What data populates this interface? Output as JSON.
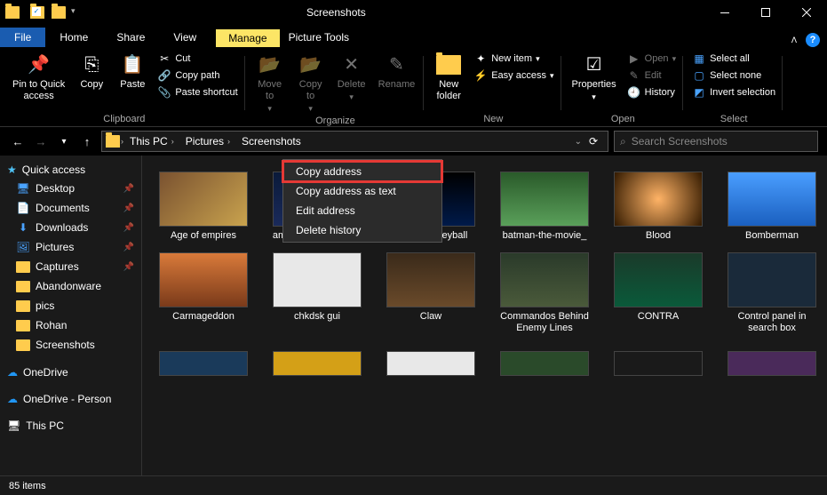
{
  "window_title": "Screenshots",
  "ribbon_group_tab": "Manage",
  "ribbon_group_sub": "Picture Tools",
  "tabs": {
    "file": "File",
    "home": "Home",
    "share": "Share",
    "view": "View"
  },
  "ribbon": {
    "pin": "Pin to Quick\naccess",
    "copy": "Copy",
    "paste": "Paste",
    "cut": "Cut",
    "copy_path": "Copy path",
    "paste_shortcut": "Paste shortcut",
    "clipboard": "Clipboard",
    "move_to": "Move\nto",
    "copy_to": "Copy\nto",
    "delete": "Delete",
    "rename": "Rename",
    "organize": "Organize",
    "new_folder": "New\nfolder",
    "new_item": "New item",
    "easy_access": "Easy access",
    "new": "New",
    "properties": "Properties",
    "open_btn": "Open",
    "edit": "Edit",
    "history": "History",
    "open_grp": "Open",
    "select_all": "Select all",
    "select_none": "Select none",
    "invert_selection": "Invert selection",
    "select": "Select"
  },
  "breadcrumb": [
    "This PC",
    "Pictures",
    "Screenshots"
  ],
  "search_placeholder": "Search Screenshots",
  "context_menu": [
    "Copy address",
    "Copy address as text",
    "Edit address",
    "Delete history"
  ],
  "sidebar": {
    "quick_access": "Quick access",
    "items": [
      {
        "label": "Desktop",
        "pin": true,
        "icon": "desktop"
      },
      {
        "label": "Documents",
        "pin": true,
        "icon": "doc"
      },
      {
        "label": "Downloads",
        "pin": true,
        "icon": "download"
      },
      {
        "label": "Pictures",
        "pin": true,
        "icon": "pic"
      },
      {
        "label": "Captures",
        "pin": true,
        "icon": "folder"
      },
      {
        "label": "Abandonware",
        "pin": false,
        "icon": "folder"
      },
      {
        "label": "pics",
        "pin": false,
        "icon": "folder"
      },
      {
        "label": "Rohan",
        "pin": false,
        "icon": "folder"
      },
      {
        "label": "Screenshots",
        "pin": false,
        "icon": "folder"
      }
    ],
    "onedrive1": "OneDrive",
    "onedrive2": "OneDrive - Person",
    "thispc": "This PC"
  },
  "files": [
    "Age of empires",
    "amazing-spider-man",
    "arcade-volleyball",
    "batman-the-movie_",
    "Blood",
    "Bomberman",
    "Carmageddon",
    "chkdsk gui",
    "Claw",
    "Commandos Behind Enemy Lines",
    "CONTRA",
    "Control panel in search box"
  ],
  "thumbs": [
    "linear-gradient(135deg,#7a5230,#c9a34e)",
    "linear-gradient(#0a1a3a,#1a2a5a)",
    "linear-gradient(#000,#001a4a)",
    "linear-gradient(#2a5a2a,#5aa05a)",
    "radial-gradient(circle,#ffb366,#331a00)",
    "linear-gradient(#4a9eff,#1a5fbf)",
    "linear-gradient(#d97a3a,#7a3a1a)",
    "#e8e8e8",
    "linear-gradient(#3a2a1a,#6a4a2a)",
    "linear-gradient(#2a3a2a,#4a5a3a)",
    "linear-gradient(#1a3a2a,#0a5a3a)",
    "#1a2a3a"
  ],
  "status": "85 items"
}
